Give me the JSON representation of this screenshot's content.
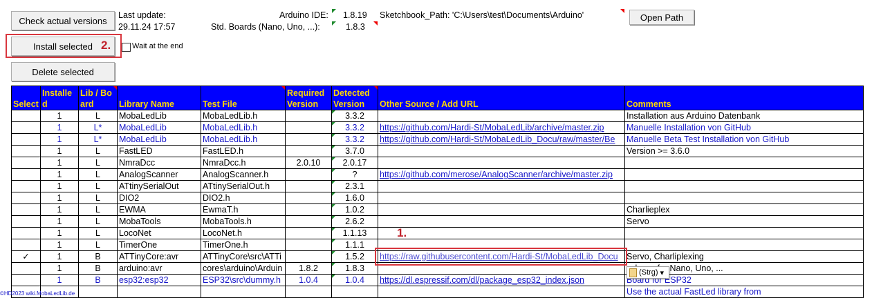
{
  "buttons": {
    "check": "Check actual versions",
    "install": "Install selected",
    "delete": "Delete selected",
    "open_path": "Open Path"
  },
  "wait_label": "Wait at the end",
  "status": {
    "last_update_label": "Last update:",
    "last_update_value": "29.11.24 17:57",
    "ide_label": "Arduino IDE:",
    "ide_version": "1.8.19",
    "boards_label": "Std. Boards (Nano, Uno, ...):",
    "boards_version": "1.8.3",
    "sketchbook": "Sketchbook_Path: 'C:\\Users\\test\\Documents\\Arduino'"
  },
  "annotations": {
    "mark1": "1.",
    "mark2": "2."
  },
  "columns": [
    "Select",
    "Installed",
    "Lib / Board",
    "Library Name",
    "Test File",
    "Required Version",
    "Detected Version",
    "Other Source / Add URL",
    "Comments"
  ],
  "rows": [
    {
      "sel": "",
      "inst": "1",
      "lb": "L",
      "name": "MobaLedLib",
      "file": "MobaLedLib.h",
      "req": "",
      "det": "3.3.2",
      "url": "",
      "comment": "Installation aus Arduino Datenbank",
      "blue": false
    },
    {
      "sel": "",
      "inst": "1",
      "lb": "L*",
      "name": "MobaLedLib",
      "file": "MobaLedLib.h",
      "req": "",
      "det": "3.3.2",
      "url": "https://github.com/Hardi-St/MobaLedLib/archive/master.zip",
      "comment": "Manuelle Installation von GitHub",
      "blue": true
    },
    {
      "sel": "",
      "inst": "1",
      "lb": "L*",
      "name": "MobaLedLib",
      "file": "MobaLedLib.h",
      "req": "",
      "det": "3.3.2",
      "url": "https://github.com/Hardi-St/MobaLedLib_Docu/raw/master/Be",
      "comment": "Manuelle Beta Test Installation von GitHub",
      "blue": true
    },
    {
      "sel": "",
      "inst": "1",
      "lb": "L",
      "name": "FastLED",
      "file": "FastLED.h",
      "req": "",
      "det": "3.7.0",
      "url": "",
      "comment": "Version >= 3.6.0",
      "blue": false
    },
    {
      "sel": "",
      "inst": "1",
      "lb": "L",
      "name": "NmraDcc",
      "file": "NmraDcc.h",
      "req": "2.0.10",
      "det": "2.0.17",
      "url": "",
      "comment": "",
      "blue": false
    },
    {
      "sel": "",
      "inst": "1",
      "lb": "L",
      "name": "AnalogScanner",
      "file": "AnalogScanner.h",
      "req": "",
      "det": "?",
      "url": "https://github.com/merose/AnalogScanner/archive/master.zip",
      "comment": "",
      "blue": false
    },
    {
      "sel": "",
      "inst": "1",
      "lb": "L",
      "name": "ATtinySerialOut",
      "file": "ATtinySerialOut.h",
      "req": "",
      "det": "2.3.1",
      "url": "",
      "comment": "",
      "blue": false
    },
    {
      "sel": "",
      "inst": "1",
      "lb": "L",
      "name": "DIO2",
      "file": "DIO2.h",
      "req": "",
      "det": "1.6.0",
      "url": "",
      "comment": "",
      "blue": false
    },
    {
      "sel": "",
      "inst": "1",
      "lb": "L",
      "name": "EWMA",
      "file": "EwmaT.h",
      "req": "",
      "det": "1.0.2",
      "url": "",
      "comment": "Charlieplex",
      "blue": false
    },
    {
      "sel": "",
      "inst": "1",
      "lb": "L",
      "name": "MobaTools",
      "file": "MobaTools.h",
      "req": "",
      "det": "2.6.2",
      "url": "",
      "comment": "Servo",
      "blue": false
    },
    {
      "sel": "",
      "inst": "1",
      "lb": "L",
      "name": "LocoNet",
      "file": "LocoNet.h",
      "req": "",
      "det": "1.1.13",
      "url": "",
      "comment": "",
      "blue": false
    },
    {
      "sel": "",
      "inst": "1",
      "lb": "L",
      "name": "TimerOne",
      "file": "TimerOne.h",
      "req": "",
      "det": "1.1.1",
      "url": "",
      "comment": "",
      "blue": false
    },
    {
      "sel": "✓",
      "inst": "1",
      "lb": "B",
      "name": "ATTinyCore:avr",
      "file": "ATTinyCore\\src\\ATTi",
      "req": "",
      "det": "1.5.2",
      "url": "https://raw.githubusercontent.com/Hardi-St/MobaLedLib_Docu",
      "comment": "Servo, Charliplexing",
      "blue": false
    },
    {
      "sel": "",
      "inst": "1",
      "lb": "B",
      "name": "arduino:avr",
      "file": "cores\\arduino\\Arduin",
      "req": "1.8.2",
      "det": "1.8.3",
      "url": "",
      "comment": "…brary for Nano, Uno, ...",
      "blue": false
    },
    {
      "sel": "",
      "inst": "1",
      "lb": "B",
      "name": "esp32:esp32",
      "file": "ESP32\\src\\dummy.h",
      "req": "1.0.4",
      "det": "1.0.4",
      "url": "https://dl.espressif.com/dl/package_esp32_index.json",
      "comment": "Board for ESP32",
      "blue": true
    },
    {
      "sel": "",
      "inst": "",
      "lb": "",
      "name": "",
      "file": "",
      "req": "",
      "det": "",
      "url": "",
      "comment": "Use the actual FastLed library from",
      "blue": true
    }
  ],
  "paste_popup": "(Strg)",
  "footer": "©HD2023 wiki.MobaLedLib.de",
  "colors": {
    "header_bg": "#0000ff",
    "header_text": "#ffd700",
    "link": "#1515c8",
    "annotation": "#d9363e"
  }
}
